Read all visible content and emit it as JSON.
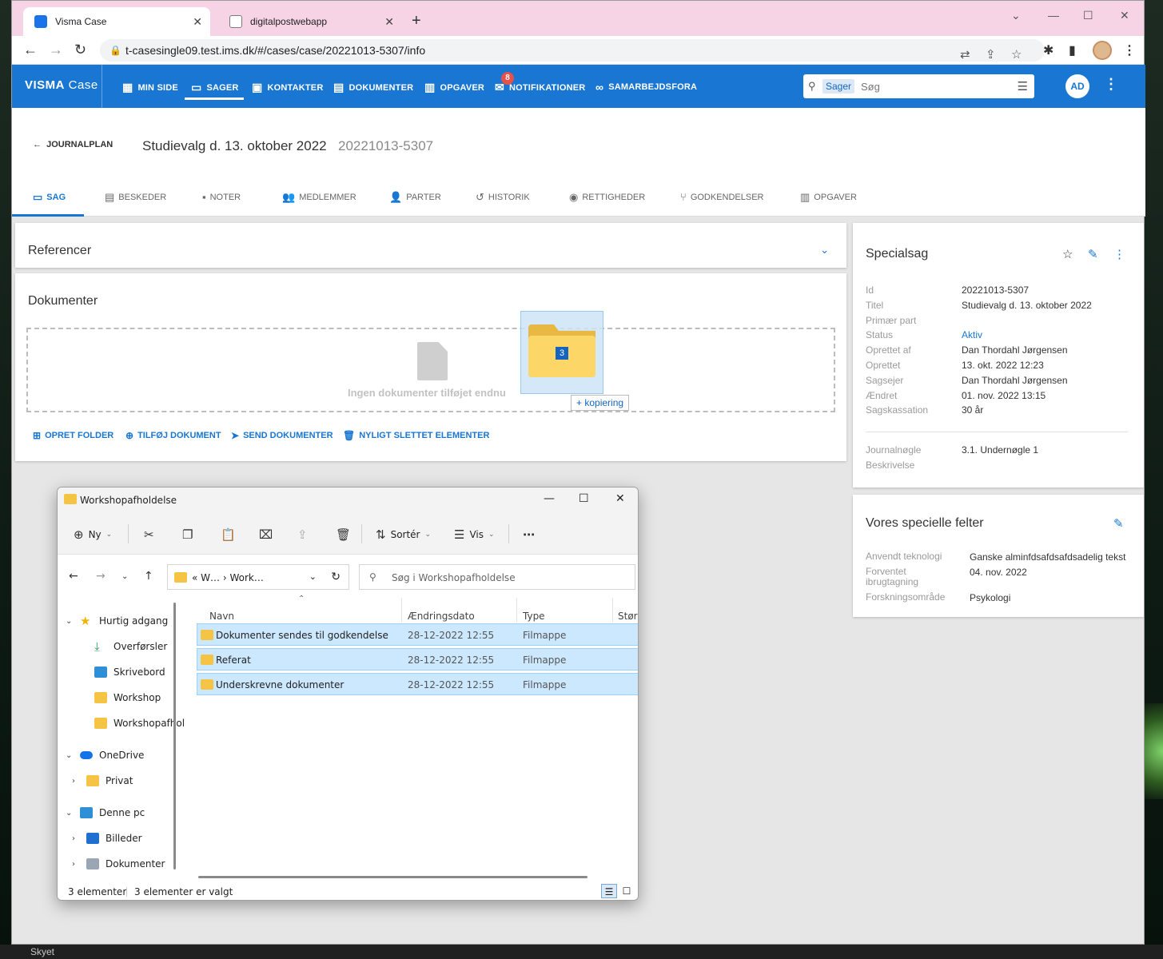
{
  "browser": {
    "tabs": [
      {
        "title": "Visma Case",
        "close": "✕"
      },
      {
        "title": "digitalpostwebapp",
        "close": "✕"
      }
    ],
    "new_tab": "+",
    "url": "t-casesingle09.test.ims.dk/#/cases/case/20221013-5307/info"
  },
  "app": {
    "brand_bold": "VISMA",
    "brand_light": " Case",
    "nav": [
      "MIN SIDE",
      "SAGER",
      "KONTAKTER",
      "DOKUMENTER",
      "OPGAVER",
      "NOTIFIKATIONER",
      "SAMARBEJDSFORA"
    ],
    "notification_count": "8",
    "search_chip": "Sager",
    "search_placeholder": "Søg",
    "user_initials": "AD"
  },
  "page": {
    "back_label": "JOURNALPLAN",
    "title": "Studievalg d. 13. oktober 2022",
    "case_id": "20221013-5307",
    "tabs": [
      "SAG",
      "BESKEDER",
      "NOTER",
      "MEDLEMMER",
      "PARTER",
      "HISTORIK",
      "RETTIGHEDER",
      "GODKENDELSER",
      "OPGAVER"
    ]
  },
  "references": {
    "title": "Referencer"
  },
  "documents": {
    "title": "Dokumenter",
    "empty_text": "Ingen dokumenter tilføjet endnu",
    "actions": [
      "OPRET FOLDER",
      "TILFØJ DOKUMENT",
      "SEND DOKUMENTER",
      "NYLIGT SLETTET ELEMENTER"
    ],
    "drag_count": "3",
    "drag_tip": "+ kopiering"
  },
  "specialsag": {
    "title": "Specialsag",
    "fields": [
      {
        "k": "Id",
        "v": "20221013-5307"
      },
      {
        "k": "Titel",
        "v": "Studievalg d. 13. oktober 2022"
      },
      {
        "k": "Primær part",
        "v": ""
      },
      {
        "k": "Status",
        "v": "Aktiv"
      },
      {
        "k": "Oprettet af",
        "v": "Dan Thordahl Jørgensen"
      },
      {
        "k": "Oprettet",
        "v": "13. okt. 2022 12:23"
      },
      {
        "k": "Sagsejer",
        "v": "Dan Thordahl Jørgensen"
      },
      {
        "k": "Ændret",
        "v": "01. nov. 2022 13:15"
      },
      {
        "k": "Sagskassation",
        "v": "30 år"
      }
    ],
    "fields2": [
      {
        "k": "Journalnøgle",
        "v": "3.1. Undernøgle 1"
      },
      {
        "k": "Beskrivelse",
        "v": ""
      }
    ]
  },
  "special_fields": {
    "title": "Vores specielle felter",
    "fields": [
      {
        "k": "Anvendt teknologi",
        "v": "Ganske alminfdsafdsafdsadelig tekst"
      },
      {
        "k": "Forventet ibrugtagning",
        "v": "04. nov. 2022"
      },
      {
        "k": "Forskningsområde",
        "v": "Psykologi"
      }
    ]
  },
  "explorer": {
    "title": "Workshopafholdelse",
    "commands": {
      "new": "Ny",
      "sort": "Sortér",
      "view": "Vis"
    },
    "path": "«  W…  ›  Work…",
    "search_placeholder": "Søg i Workshopafholdelse",
    "nav": [
      {
        "label": "Hurtig adgang"
      },
      {
        "label": "Overførsler"
      },
      {
        "label": "Skrivebord"
      },
      {
        "label": "Workshop"
      },
      {
        "label": "Workshopafhol"
      },
      {
        "label": "OneDrive"
      },
      {
        "label": "Privat"
      },
      {
        "label": "Denne pc"
      },
      {
        "label": "Billeder"
      },
      {
        "label": "Dokumenter"
      }
    ],
    "columns": [
      "Navn",
      "Ændringsdato",
      "Type",
      "Størr"
    ],
    "files": [
      {
        "name": "Dokumenter sendes til godkendelse",
        "date": "28-12-2022 12:55",
        "type": "Filmappe"
      },
      {
        "name": "Referat",
        "date": "28-12-2022 12:55",
        "type": "Filmappe"
      },
      {
        "name": "Underskrevne dokumenter",
        "date": "28-12-2022 12:55",
        "type": "Filmappe"
      }
    ],
    "status_count": "3 elementer",
    "status_selected": "3 elementer er valgt"
  },
  "taskbar": {
    "weather": "Skyet"
  }
}
